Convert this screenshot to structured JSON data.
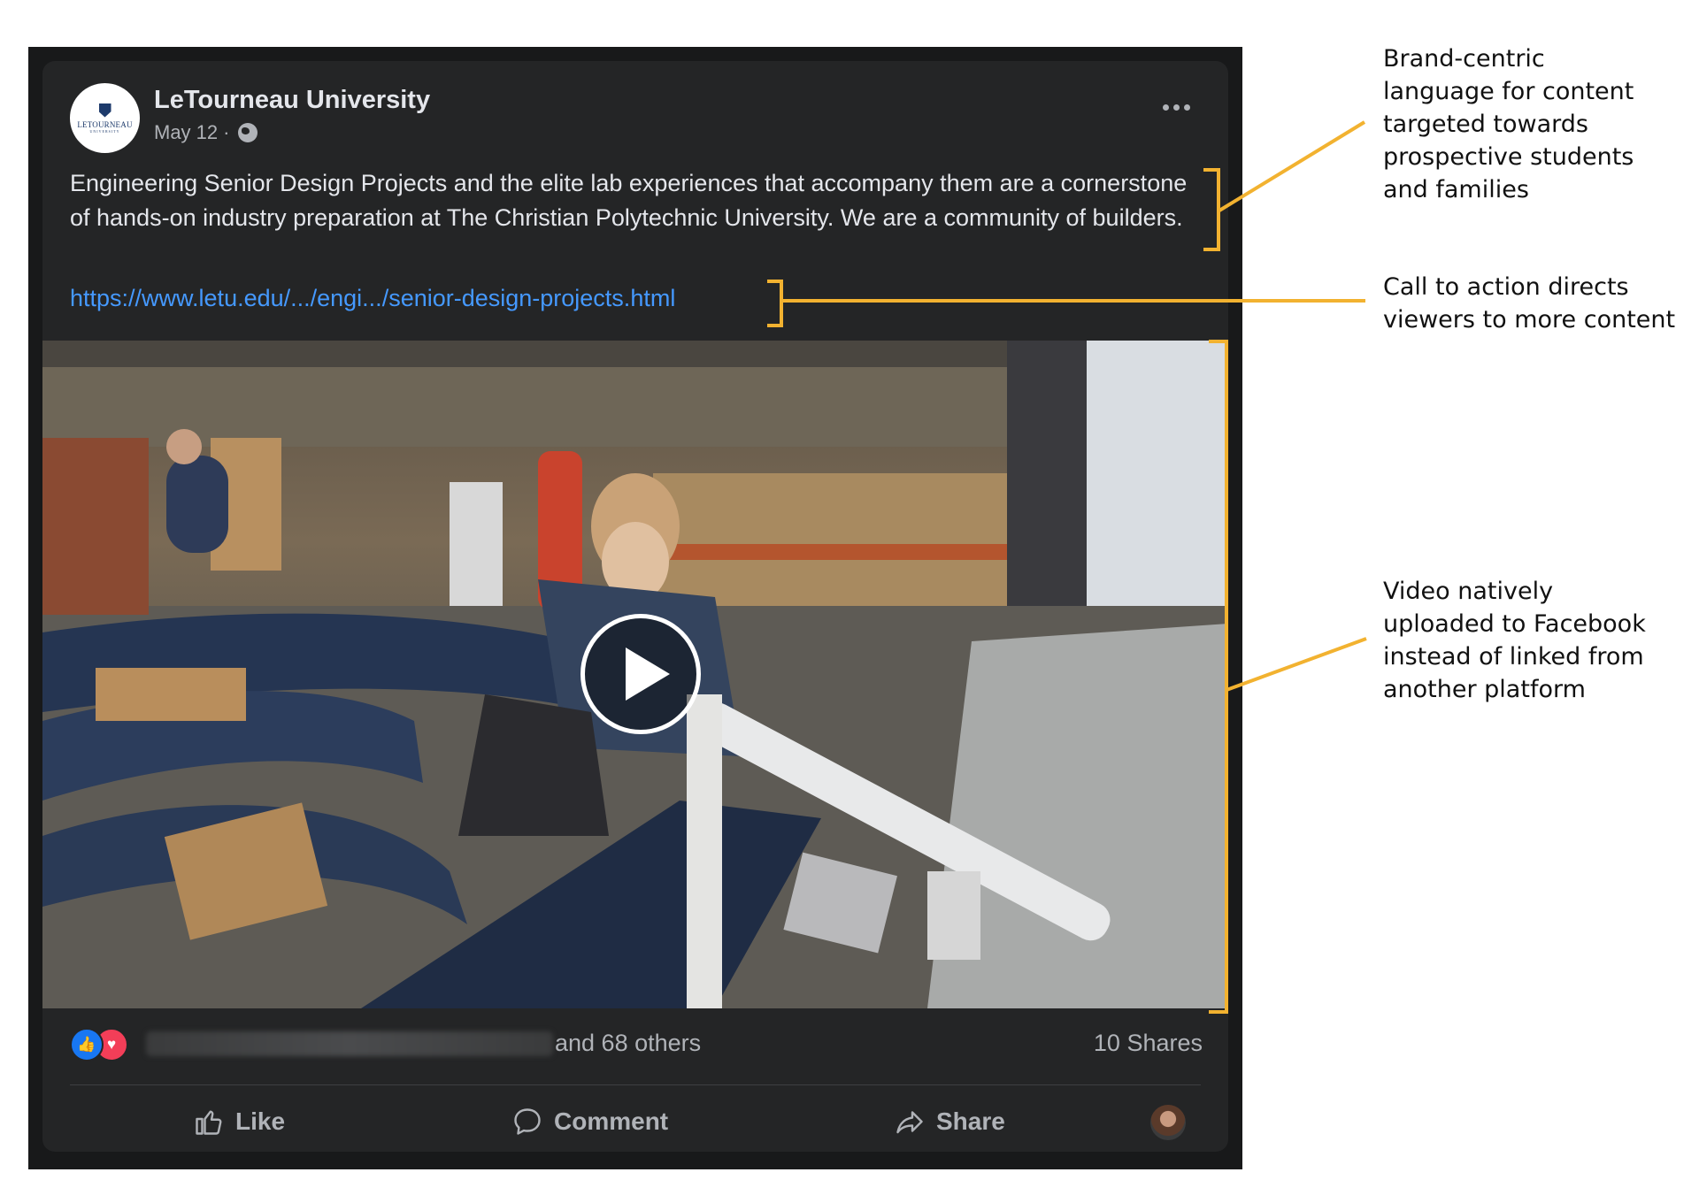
{
  "post": {
    "page_name": "LeTourneau University",
    "avatar_logo_text": "LETOURNEAU",
    "avatar_logo_subtext": "UNIVERSITY",
    "date": "May 12",
    "date_separator": "·",
    "audience_icon": "globe-icon",
    "menu_icon": "more-options-icon",
    "text": "Engineering Senior Design Projects and the elite lab experiences that accompany them are a cornerstone of hands-on industry preparation at The Christian Polytechnic University. We are a community of builders.",
    "link": "https://www.letu.edu/.../engi.../senior-design-projects.html",
    "video_control_icon": "play-icon"
  },
  "engagement": {
    "reaction_icons": [
      "like-reaction-icon",
      "love-reaction-icon"
    ],
    "reaction_glyphs": {
      "like": "👍",
      "love": "♥"
    },
    "others_text": "and 68 others",
    "shares_text": "10 Shares"
  },
  "actions": {
    "like_label": "Like",
    "comment_label": "Comment",
    "share_label": "Share"
  },
  "annotations": {
    "accent_color": "#f2b230",
    "brand": "Brand-centric\nlanguage for content\ntargeted towards\nprospective students\nand families",
    "cta": "Call to action directs\nviewers to more content",
    "video": "Video natively\nuploaded to Facebook\ninstead of linked from\nanother platform"
  },
  "colors": {
    "card_background": "#242526",
    "primary_text": "#e4e6eb",
    "secondary_text": "#b0b3b8",
    "link": "#4599ff",
    "like_blue": "#1877f2",
    "love_red": "#f33e58"
  }
}
